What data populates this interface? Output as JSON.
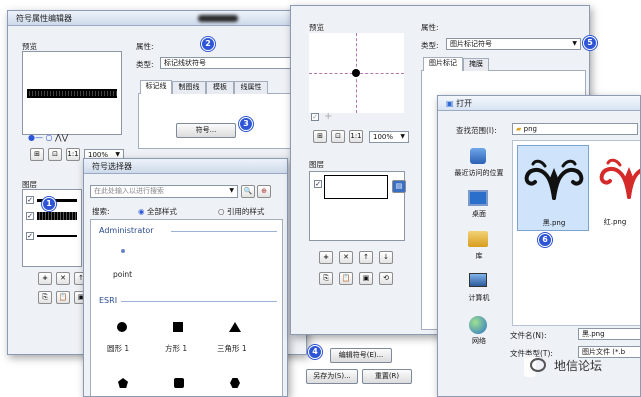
{
  "symbol_editor": {
    "title": "符号属性编辑器",
    "preview_label": "预览",
    "properties_label": "属性:",
    "type_label": "类型:",
    "type_value": "标记线状符号",
    "tabs": [
      "标记线",
      "制图线",
      "模板",
      "线属性"
    ],
    "symbol_button": "符号...",
    "zoom_value": "100%",
    "layers_label": "图层"
  },
  "symbol_selector": {
    "title": "符号选择器",
    "search_placeholder": "在此处输入以进行搜索",
    "search_label": "搜索:",
    "radio_all": "全部样式",
    "radio_referenced": "引用的样式",
    "group_admin": "Administrator",
    "point_label": "point",
    "group_esri": "ESRI",
    "symbols": [
      "圆形 1",
      "方形 1",
      "三角形 1"
    ]
  },
  "marker_editor": {
    "preview_label": "预览",
    "properties_label": "属性:",
    "type_label": "类型:",
    "type_value": "图片标记符号",
    "tabs": [
      "图片标记",
      "掩膜"
    ],
    "zoom_value": "100%",
    "layers_label": "图层",
    "edit_symbol_button": "编辑符号(E)...",
    "save_as_button": "另存为(S)...",
    "reset_button": "重置(R)"
  },
  "open_dialog": {
    "title": "打开",
    "lookin_label": "查找范围(I):",
    "lookin_value": "png",
    "places": [
      "最近访问的位置",
      "桌面",
      "库",
      "计算机",
      "网络"
    ],
    "files": [
      "黑.png",
      "红.png"
    ],
    "filename_label": "文件名(N):",
    "filename_value": "黑.png",
    "filetype_label": "文件类型(T):",
    "filetype_value": "图片文件 (*.b"
  },
  "badges": [
    "1",
    "2",
    "3",
    "4",
    "5",
    "6"
  ],
  "watermark": "地信论坛",
  "colors": {
    "accent": "#2e55d6",
    "selection": "#cfe3fb",
    "black_icon": "#111111",
    "red_icon": "#d42a2a"
  }
}
